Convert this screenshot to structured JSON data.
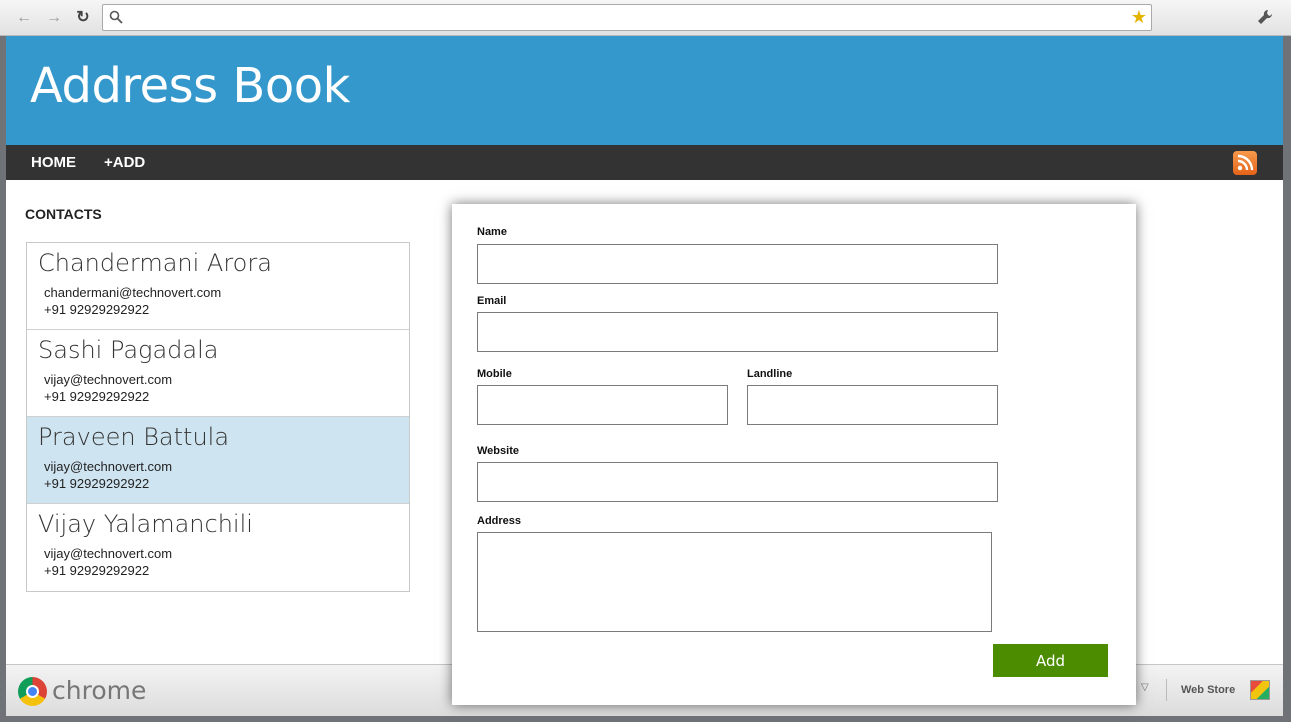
{
  "browser": {
    "back_icon": "←",
    "forward_icon": "→",
    "reload_icon": "↻",
    "address_value": "",
    "star_icon": "★",
    "bottom": {
      "brand": "chrome",
      "webstore": "Web Store"
    }
  },
  "app": {
    "title": "Address Book",
    "nav": {
      "home": "HOME",
      "add": "+ADD"
    }
  },
  "contacts": {
    "heading": "CONTACTS",
    "items": [
      {
        "name": "Chandermani Arora",
        "email": "chandermani@technovert.com",
        "phone": "+91 92929292922"
      },
      {
        "name": "Sashi Pagadala",
        "email": "vijay@technovert.com",
        "phone": "+91 92929292922"
      },
      {
        "name": "Praveen Battula",
        "email": "vijay@technovert.com",
        "phone": "+91 92929292922"
      },
      {
        "name": "Vijay Yalamanchili",
        "email": "vijay@technovert.com",
        "phone": "+91 92929292922"
      }
    ],
    "selected_index": 2
  },
  "form": {
    "name_label": "Name",
    "name_value": "",
    "email_label": "Email",
    "email_value": "",
    "mobile_label": "Mobile",
    "mobile_value": "",
    "landline_label": "Landline",
    "landline_value": "",
    "website_label": "Website",
    "website_value": "",
    "address_label": "Address",
    "address_value": "",
    "submit_label": "Add"
  },
  "colors": {
    "header": "#3498cc",
    "navbar": "#333333",
    "selected_row": "#cfe4f1",
    "add_button": "#4c8c00"
  }
}
